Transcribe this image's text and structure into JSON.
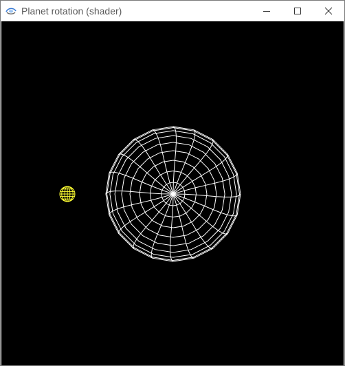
{
  "window": {
    "title": "Planet rotation (shader)"
  },
  "icons": {
    "app": "app-icon",
    "minimize": "minimize-icon",
    "maximize": "maximize-icon",
    "close": "close-icon"
  },
  "scene": {
    "background_color": "#000000",
    "planet_color": "#ffffff",
    "moon_color": "#ffff33"
  }
}
